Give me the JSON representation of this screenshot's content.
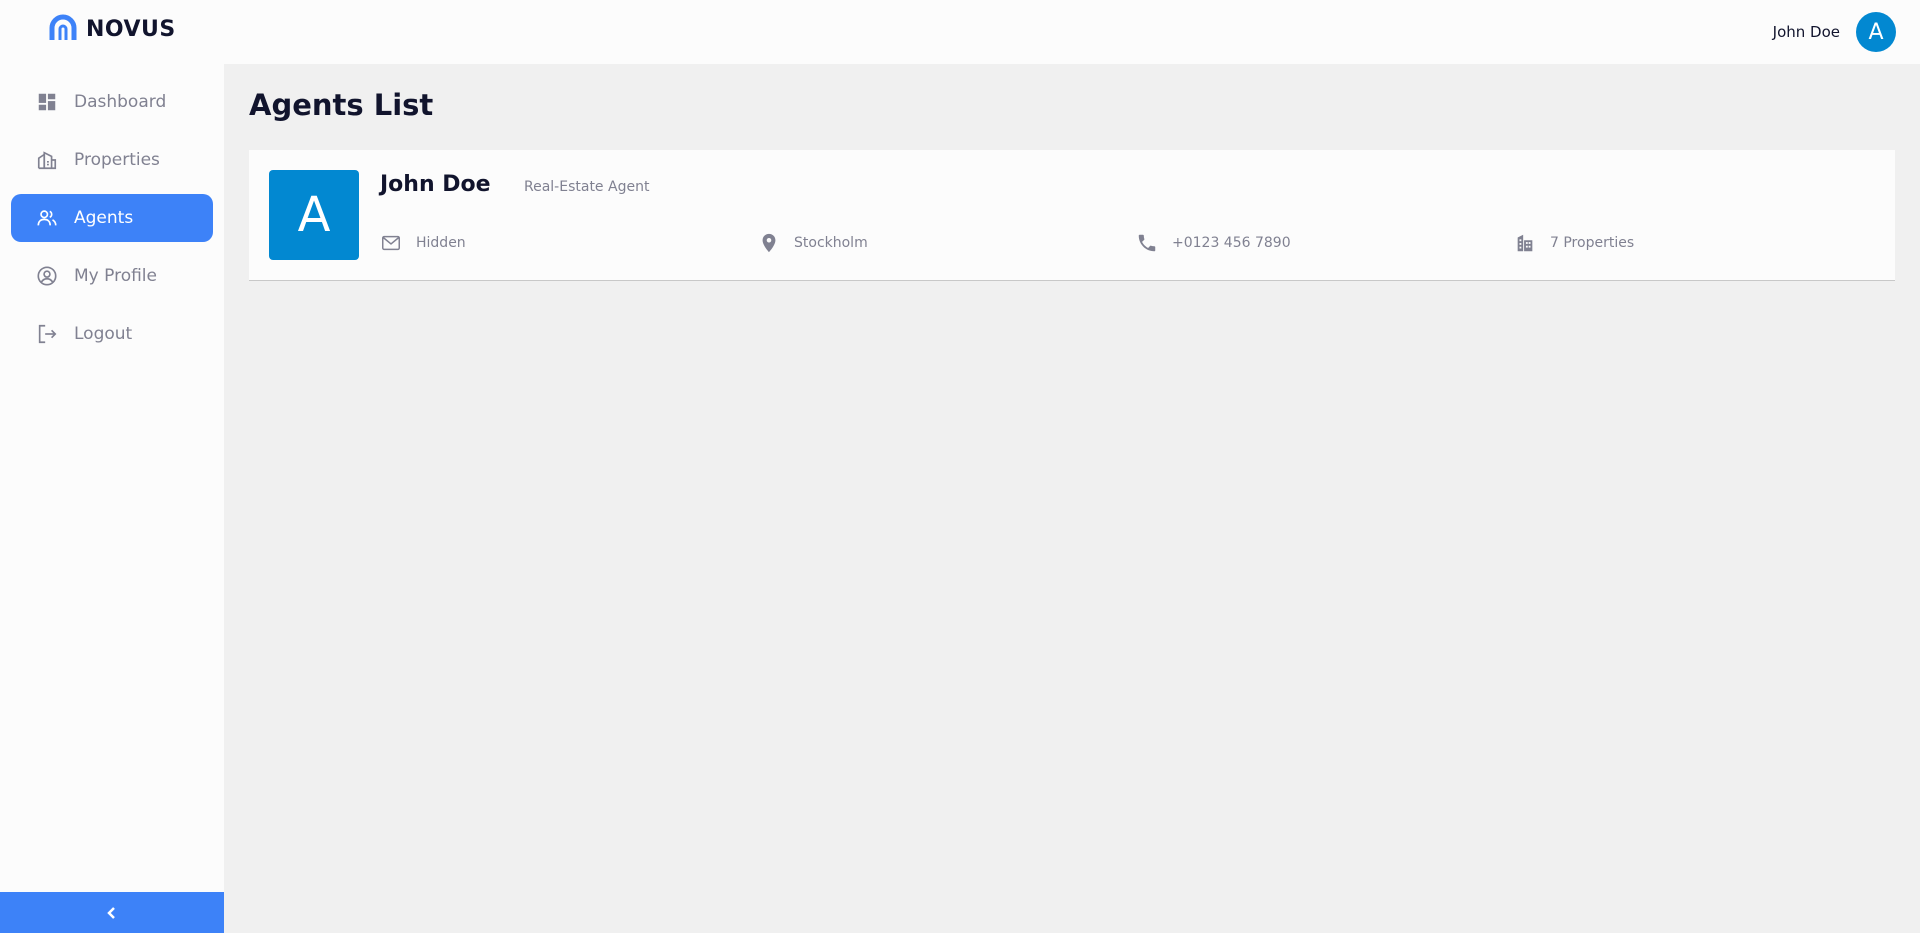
{
  "brand": {
    "name": "NOVUS",
    "accent": "#3d82f8"
  },
  "header": {
    "user_name": "John Doe",
    "avatar_initial": "A"
  },
  "sidebar": {
    "items": [
      {
        "label": "Dashboard",
        "icon": "dashboard-icon",
        "active": false
      },
      {
        "label": "Properties",
        "icon": "properties-icon",
        "active": false
      },
      {
        "label": "Agents",
        "icon": "agents-icon",
        "active": true
      },
      {
        "label": "My Profile",
        "icon": "profile-icon",
        "active": false
      },
      {
        "label": "Logout",
        "icon": "logout-icon",
        "active": false
      }
    ],
    "collapse_icon": "chevron-left-icon"
  },
  "main": {
    "title": "Agents List",
    "agents": [
      {
        "avatar_initial": "A",
        "name": "John Doe",
        "role": "Real-Estate Agent",
        "email": "Hidden",
        "location": "Stockholm",
        "phone": "+0123 456 7890",
        "properties": "7 Properties"
      }
    ]
  }
}
